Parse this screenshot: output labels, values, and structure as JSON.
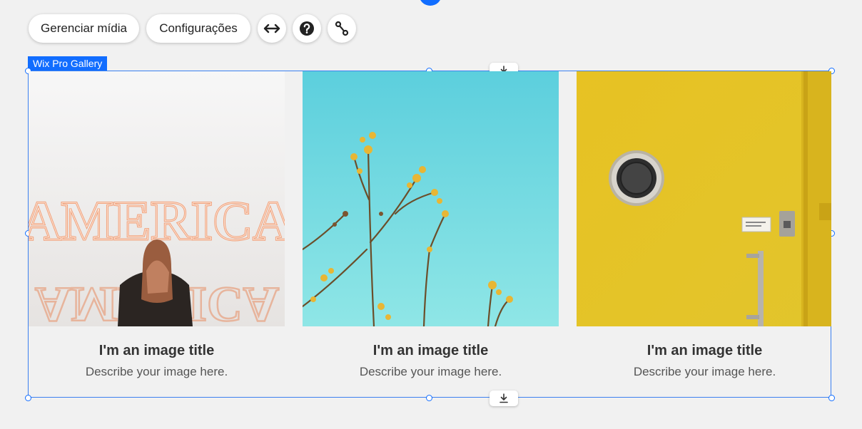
{
  "toolbar": {
    "manage_media": "Gerenciar mídia",
    "settings": "Configurações",
    "stretch_icon": "horizontal-arrows-icon",
    "help_icon": "help-icon",
    "connect_icon": "connect-nodes-icon"
  },
  "component": {
    "label": "Wix Pro Gallery",
    "accent_color": "#116dff",
    "drag_icon": "download-arrow-icon"
  },
  "gallery": {
    "items": [
      {
        "image": "neon AMERICA sign with woman",
        "title": "I'm an image title",
        "description": "Describe your image here."
      },
      {
        "image": "yellow flowers against blue sky",
        "title": "I'm an image title",
        "description": "Describe your image here."
      },
      {
        "image": "yellow door with porthole window",
        "title": "I'm an image title",
        "description": "Describe your image here."
      }
    ]
  }
}
